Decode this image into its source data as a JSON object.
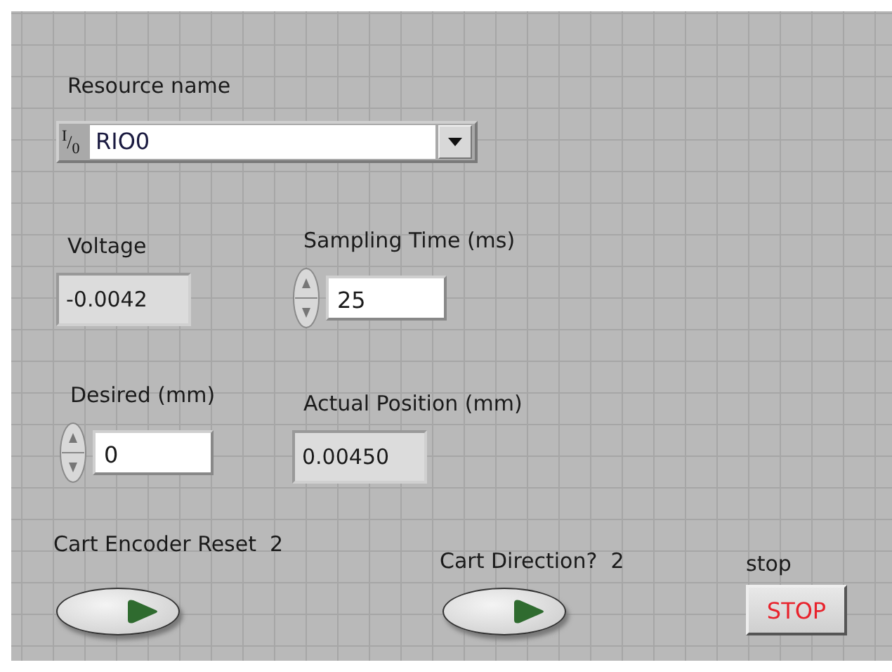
{
  "resource": {
    "label": "Resource name",
    "prefix": "$^{I}$/$_{0}$",
    "value": "RIO0"
  },
  "voltage": {
    "label": "Voltage",
    "value": "-0.0042",
    "kind": "indicator"
  },
  "sampling_time": {
    "label": "Sampling Time (ms)",
    "value": "25",
    "kind": "control"
  },
  "desired": {
    "label": "Desired (mm)",
    "value": "0",
    "kind": "control"
  },
  "actual_position": {
    "label": "Actual Position (mm)",
    "value": "0.00450",
    "kind": "indicator"
  },
  "switches": [
    {
      "label": "Cart Encoder Reset  2",
      "on": false
    },
    {
      "label": "Cart Direction?  2",
      "on": false
    }
  ],
  "stop": {
    "label": "stop",
    "text": "STOP",
    "on": false
  }
}
